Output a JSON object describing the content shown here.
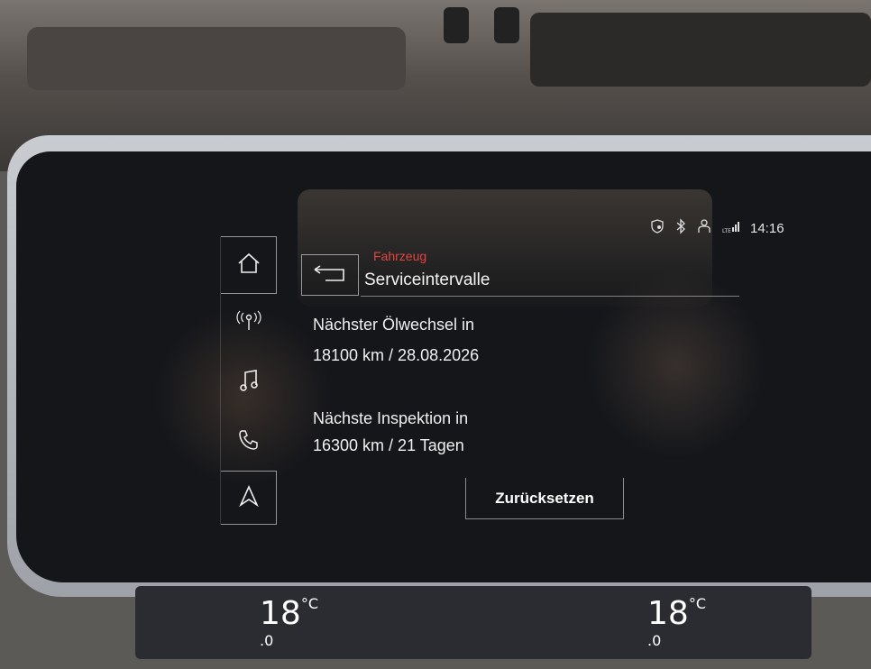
{
  "header": {
    "breadcrumb": "Fahrzeug",
    "title": "Serviceintervalle"
  },
  "status": {
    "time": "14:16",
    "icons": [
      "shield-location-icon",
      "bluetooth-icon",
      "profile-icon",
      "lte-signal-icon"
    ]
  },
  "sidebar": {
    "items": [
      {
        "icon": "home-icon"
      },
      {
        "icon": "radio-icon"
      },
      {
        "icon": "music-note-icon"
      },
      {
        "icon": "phone-icon"
      },
      {
        "icon": "navigation-icon"
      }
    ]
  },
  "service": {
    "oil_label": "Nächster Ölwechsel in",
    "oil_value": "18100 km / 28.08.2026",
    "inspection_label": "Nächste Inspektion in",
    "inspection_value": "16300 km / 21 Tagen"
  },
  "actions": {
    "reset_label": "Zurücksetzen"
  },
  "climate": {
    "left_temp": "18",
    "left_decimal": ".0",
    "right_temp": "18",
    "right_decimal": ".0",
    "unit": "°C"
  },
  "colors": {
    "accent": "#e0463e",
    "screen_bg": "#14161a",
    "text": "#f0f0f0"
  }
}
